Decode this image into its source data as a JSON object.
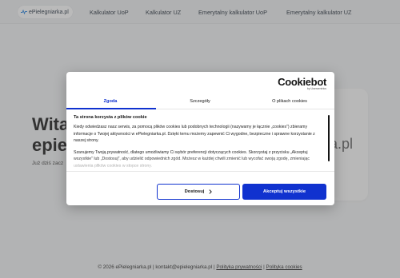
{
  "header": {
    "logo_text": "ePielegniarka.pl",
    "nav": [
      "Kalkulator UoP",
      "Kalkulator UZ",
      "Emerytalny kalkulator UoP",
      "Emerytalny kalkulator UZ"
    ]
  },
  "hero": {
    "title_line1": "Wita",
    "title_line2": "epie",
    "subtitle": "Już dziś zacz",
    "card_text": "a.pl"
  },
  "cookie_dialog": {
    "brand": "Cookiebot",
    "brand_sub": "by Usercentrics",
    "tabs": [
      "Zgoda",
      "Szczegóły",
      "O plikach cookies"
    ],
    "active_tab": "Zgoda",
    "content_title": "Ta strona korzysta z plików cookie",
    "paragraph1": "Kiedy odwiedzasz nasz serwis, za pomocą plików cookies lub podobnych technologii (nazywamy je łącznie „cookies”) zbieramy informacje o Twojej aktywności w ePielegniarka.pl. Dzięki temu możemy zapewnić Ci wygodne, bezpieczne i sprawne korzystanie z naszej strony.",
    "paragraph2": "Szanujemy Twoją prywatność, dlatego umożliwiamy Ci wybór preferencji dotyczących cookies. Skorzystaj z przycisku „Akceptuj wszystkie” lub „Dostosuj”, aby udzielić odpowiednich zgód. Możesz w każdej chwili zmienić lub wycofać swoją zgodę, zmieniając ustawienia plików cookies w stopce strony.",
    "customize_label": "Dostosuj",
    "accept_label": "Akceptuj wszystkie",
    "accent_color": "#1032cf"
  },
  "footer": {
    "copyright": "© 2026 ePielegniarka.pl | kontakt@epielegniarka.pl | ",
    "privacy_link": "Polityka prywatności",
    "separator": " | ",
    "cookies_link": "Polityka cookies"
  }
}
